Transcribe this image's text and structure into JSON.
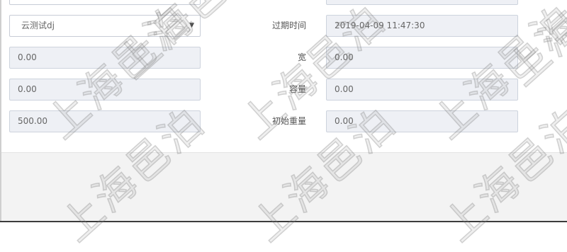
{
  "form": {
    "left": {
      "select_value": "云测试dj",
      "field1": "0.00",
      "field2": "0.00",
      "field3": "500.00"
    },
    "right": {
      "expire_label": "过期时间",
      "expire_value": "2019-04-09 11:47:30",
      "width_label": "宽",
      "width_value": "0.00",
      "capacity_label": "容量",
      "capacity_value": "0.00",
      "initial_weight_label": "初始重量",
      "initial_weight_value": "0.00"
    }
  },
  "watermark": {
    "text": "上海邑泊"
  },
  "icons": {
    "select_caret": "caret-down-icon"
  }
}
